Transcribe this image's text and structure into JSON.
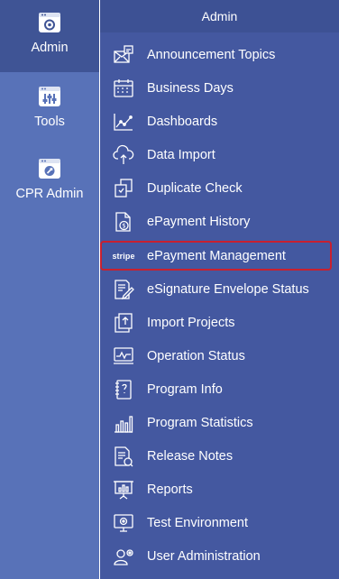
{
  "rail": {
    "items": [
      {
        "label": "Admin",
        "icon": "admin-gear-icon",
        "active": true
      },
      {
        "label": "Tools",
        "icon": "tools-sliders-icon",
        "active": false
      },
      {
        "label": "CPR Admin",
        "icon": "cpr-admin-icon",
        "active": false
      }
    ]
  },
  "panel": {
    "title": "Admin",
    "items": [
      {
        "label": "Announcement Topics",
        "icon": "announcement-topics-icon"
      },
      {
        "label": "Business Days",
        "icon": "calendar-icon"
      },
      {
        "label": "Dashboards",
        "icon": "line-chart-icon"
      },
      {
        "label": "Data Import",
        "icon": "cloud-upload-icon"
      },
      {
        "label": "Duplicate Check",
        "icon": "duplicate-icon"
      },
      {
        "label": "ePayment History",
        "icon": "payment-history-icon"
      },
      {
        "label": "ePayment Management",
        "icon": "stripe-icon",
        "icon_text": "stripe",
        "highlighted": true
      },
      {
        "label": "eSignature Envelope Status",
        "icon": "signature-document-icon"
      },
      {
        "label": "Import Projects",
        "icon": "import-projects-icon"
      },
      {
        "label": "Operation Status",
        "icon": "monitor-status-icon"
      },
      {
        "label": "Program Info",
        "icon": "program-info-icon"
      },
      {
        "label": "Program Statistics",
        "icon": "bar-chart-icon"
      },
      {
        "label": "Release Notes",
        "icon": "release-notes-icon"
      },
      {
        "label": "Reports",
        "icon": "presentation-icon"
      },
      {
        "label": "Test Environment",
        "icon": "test-environment-icon"
      },
      {
        "label": "User Administration",
        "icon": "user-admin-icon"
      }
    ]
  },
  "colors": {
    "rail_bg": "#5872b8",
    "rail_active_bg": "#3f5495",
    "panel_bg": "#4458a0",
    "highlight_border": "#c8202f"
  }
}
